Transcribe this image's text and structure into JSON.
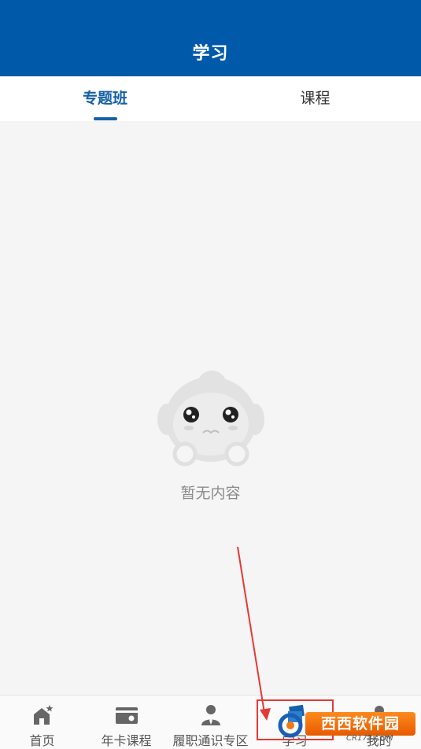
{
  "header": {
    "title": "学习"
  },
  "tabs": [
    {
      "label": "专题班",
      "active": true
    },
    {
      "label": "课程",
      "active": false
    }
  ],
  "empty_state": {
    "message": "暂无内容"
  },
  "tabbar": [
    {
      "label": "首页",
      "icon": "home-icon"
    },
    {
      "label": "年卡课程",
      "icon": "card-icon"
    },
    {
      "label": "履职通识专区",
      "icon": "person-icon"
    },
    {
      "label": "学习",
      "icon": "book-icon"
    },
    {
      "label": "我的",
      "icon": "user-icon"
    }
  ],
  "watermark": {
    "text": "西西软件园",
    "sub": "CR173.COM"
  },
  "colors": {
    "primary": "#0059a9",
    "accent": "#1560a8",
    "annotation": "#e53935"
  }
}
